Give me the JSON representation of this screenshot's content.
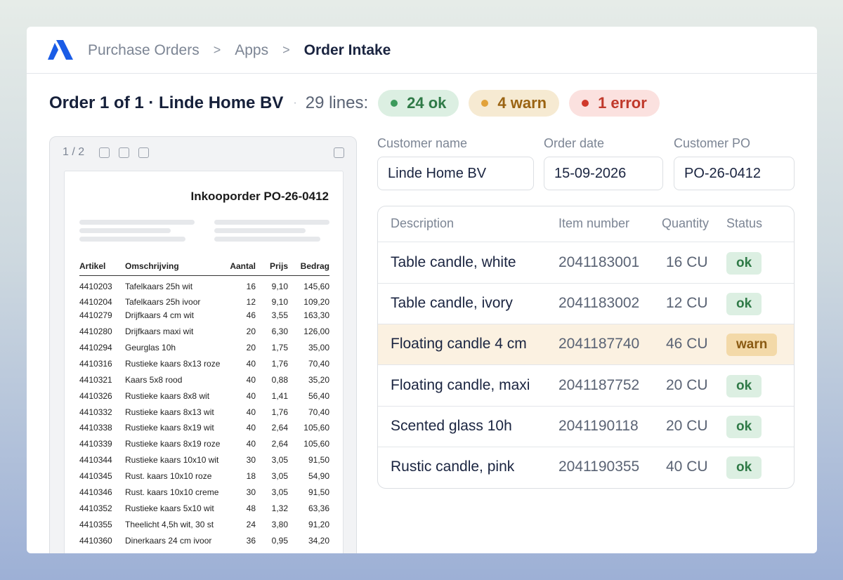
{
  "breadcrumb": [
    "Purchase Orders",
    "Apps",
    "Order Intake"
  ],
  "separator": ">",
  "order": {
    "title": "Order 1 of 1 · Linde Home BV",
    "separator": "·",
    "lines_label": "29 lines:",
    "ok_label": "24 ok",
    "warn_label": "4 warn",
    "error_label": "1 error"
  },
  "viewer": {
    "page_count": "1 / 2",
    "doc_title": "Inkooporder PO-26-0412",
    "columns": [
      "Artikel",
      "Omschrijving",
      "Aantal",
      "Prijs",
      "Bedrag"
    ],
    "rows": [
      [
        "4410203",
        "Tafelkaars 25h wit",
        "16",
        "9,10",
        "145,60"
      ],
      [
        "4410204",
        "Tafelkaars 25h ivoor",
        "12",
        "9,10",
        "109,20"
      ],
      [
        "4410279",
        "Drijfkaars 4 cm wit",
        "46",
        "3,55",
        "163,30"
      ],
      [
        "4410280",
        "Drijfkaars maxi wit",
        "20",
        "6,30",
        "126,00"
      ],
      [
        "4410294",
        "Geurglas 10h",
        "20",
        "1,75",
        "35,00"
      ],
      [
        "4410316",
        "Rustieke kaars 8x13 roze",
        "40",
        "1,76",
        "70,40"
      ],
      [
        "4410321",
        "Kaars 5x8 rood",
        "40",
        "0,88",
        "35,20"
      ],
      [
        "4410326",
        "Rustieke kaars 8x8 wit",
        "40",
        "1,41",
        "56,40"
      ],
      [
        "4410332",
        "Rustieke kaars 8x13 wit",
        "40",
        "1,76",
        "70,40"
      ],
      [
        "4410338",
        "Rustieke kaars 8x19 wit",
        "40",
        "2,64",
        "105,60"
      ],
      [
        "4410339",
        "Rustieke kaars 8x19 roze",
        "40",
        "2,64",
        "105,60"
      ],
      [
        "4410344",
        "Rustieke kaars 10x10 wit",
        "30",
        "3,05",
        "91,50"
      ],
      [
        "4410345",
        "Rust. kaars 10x10 roze",
        "18",
        "3,05",
        "54,90"
      ],
      [
        "4410346",
        "Rust. kaars 10x10 creme",
        "30",
        "3,05",
        "91,50"
      ],
      [
        "4410352",
        "Rustieke kaars 5x10 wit",
        "48",
        "1,32",
        "63,36"
      ],
      [
        "4410355",
        "Theelicht 4,5h wit, 30 st",
        "24",
        "3,80",
        "91,20"
      ],
      [
        "4410360",
        "Dinerkaars 24 cm ivoor",
        "36",
        "0,95",
        "34,20"
      ]
    ]
  },
  "form": {
    "customer_name_label": "Customer name",
    "customer_name": "Linde Home BV",
    "order_date_label": "Order date",
    "order_date": "15-09-2026",
    "customer_po_label": "Customer PO",
    "customer_po": "PO-26-0412"
  },
  "lines_table": {
    "columns": [
      "Description",
      "Item number",
      "Quantity",
      "Status"
    ],
    "rows": [
      {
        "description": "Table candle, white",
        "item": "2041183001",
        "qty": "16 CU",
        "status": "ok"
      },
      {
        "description": "Table candle, ivory",
        "item": "2041183002",
        "qty": "12 CU",
        "status": "ok"
      },
      {
        "description": "Floating candle 4 cm",
        "item": "2041187740",
        "qty": "46 CU",
        "status": "warn"
      },
      {
        "description": "Floating candle, maxi",
        "item": "2041187752",
        "qty": "20 CU",
        "status": "ok"
      },
      {
        "description": "Scented glass 10h",
        "item": "2041190118",
        "qty": "20 CU",
        "status": "ok"
      },
      {
        "description": "Rustic candle, pink",
        "item": "2041190355",
        "qty": "40 CU",
        "status": "ok"
      }
    ]
  },
  "colors": {
    "ok": "#2f7a47",
    "warn": "#9a6312",
    "error": "#c0392b",
    "brand": "#1a5ce6"
  },
  "icons": [
    "brand-logo-icon",
    "chevron-right-icon",
    "status-dot-icon",
    "checkbox-icon"
  ]
}
